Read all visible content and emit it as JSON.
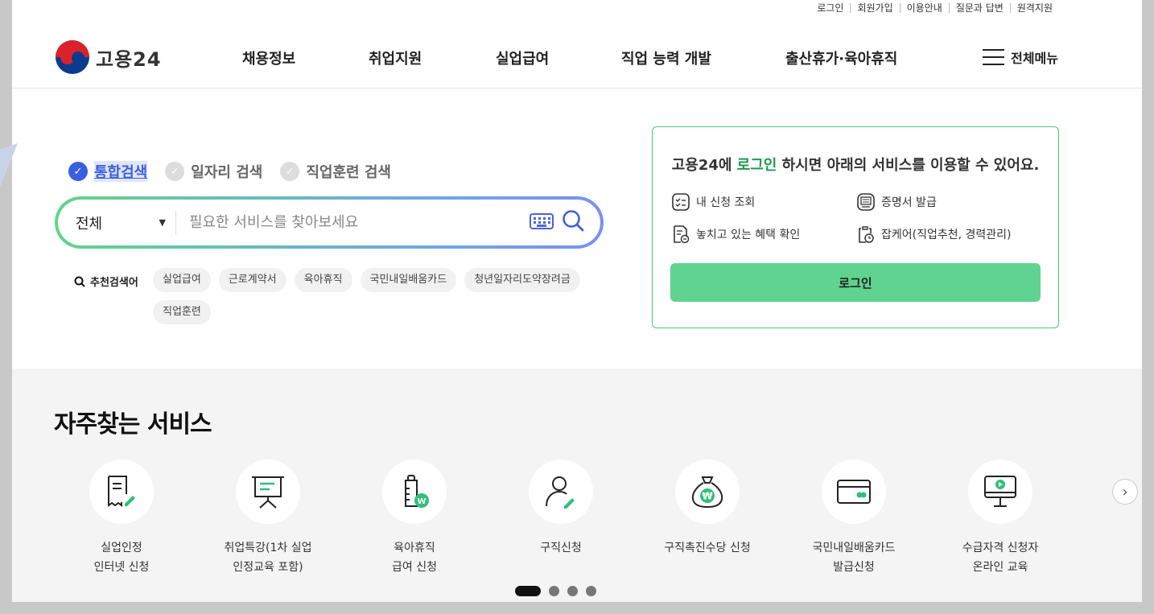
{
  "utility_links": [
    "로그인",
    "회원가입",
    "이용안내",
    "질문과 답변",
    "원격지원"
  ],
  "logo": {
    "text": "고용24"
  },
  "gnb": [
    "채용정보",
    "취업지원",
    "실업급여",
    "직업 능력 개발",
    "출산휴가·육아휴직"
  ],
  "all_menu_label": "전체메뉴",
  "search": {
    "tabs": [
      "통합검색",
      "일자리 검색",
      "직업훈련 검색"
    ],
    "active_tab": 0,
    "select_value": "전체",
    "placeholder": "필요한 서비스를 찾아보세요",
    "recommend_title": "추천검색어",
    "recommend": [
      "실업급여",
      "근로계약서",
      "육아휴직",
      "국민내일배움카드",
      "청년일자리도약장려금",
      "직업훈련"
    ]
  },
  "login_card": {
    "msg_prefix": "고용24에 ",
    "msg_highlight": "로그인",
    "msg_suffix": " 하시면 아래의 서비스를 이용할 수 있어요.",
    "services": [
      "내 신청 조회",
      "증명서 발급",
      "놓치고 있는 혜택 확인",
      "잡케어(직업추천, 경력관리)"
    ],
    "button": "로그인"
  },
  "frequent": {
    "title": "자주찾는 서비스",
    "items": [
      {
        "line1": "실업인정",
        "line2": "인터넷 신청",
        "icon": "receipt-pen-icon"
      },
      {
        "line1": "취업특강(1차 실업",
        "line2": "인정교육 포함)",
        "icon": "presentation-board-icon"
      },
      {
        "line1": "육아휴직",
        "line2": "급여 신청",
        "icon": "baby-bottle-icon"
      },
      {
        "line1": "구직신청",
        "line2": "",
        "icon": "person-pen-icon"
      },
      {
        "line1": "구직촉진수당 신청",
        "line2": "",
        "icon": "money-bag-icon"
      },
      {
        "line1": "국민내일배움카드",
        "line2": "발급신청",
        "icon": "card-icon"
      },
      {
        "line1": "수급자격 신청자",
        "line2": "온라인 교육",
        "icon": "monitor-play-icon"
      }
    ]
  },
  "colors": {
    "accent_green": "#5fd38f",
    "accent_blue": "#3b5fe0"
  }
}
